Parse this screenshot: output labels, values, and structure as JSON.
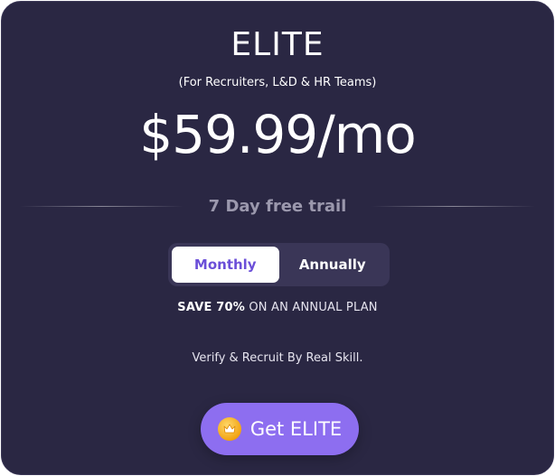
{
  "plan": {
    "title": "ELITE",
    "subtitle": "(For Recruiters, L&D & HR Teams)",
    "price": "$59.99/mo"
  },
  "trial": {
    "text": "7 Day free trail"
  },
  "billing_toggle": {
    "options": [
      "Monthly",
      "Annually"
    ],
    "selected": "Monthly"
  },
  "save_note": {
    "strong": "SAVE 70%",
    "rest": " ON AN ANNUAL PLAN"
  },
  "tagline": "Verify & Recruit By Real Skill.",
  "cta": {
    "label": "Get ELITE",
    "icon": "crown-icon"
  },
  "colors": {
    "card_bg": "#2a2743",
    "accent": "#8d6ef0",
    "active_text": "#6b4fd8",
    "muted_text": "#9b98ad"
  }
}
